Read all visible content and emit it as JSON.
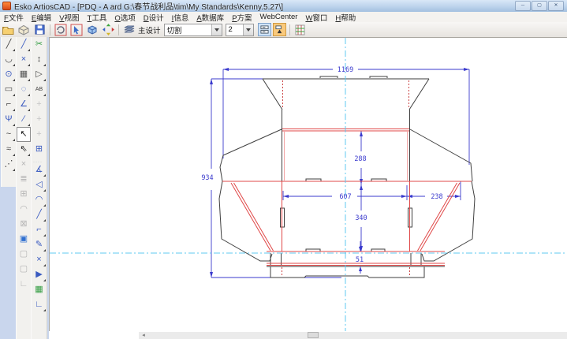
{
  "window": {
    "title": "Esko ArtiosCAD - [PDQ - A ard G:\\春节战利品\\tim\\My Standards\\Kenny.5.27\\]",
    "buttons": {
      "minimize": "─",
      "maximize": "▢",
      "close": "✕"
    }
  },
  "menu": {
    "items": [
      {
        "key": "F",
        "label": "文件"
      },
      {
        "key": "E",
        "label": "编辑"
      },
      {
        "key": "V",
        "label": "视图"
      },
      {
        "key": "T",
        "label": "工具"
      },
      {
        "key": "O",
        "label": "选项"
      },
      {
        "key": "D",
        "label": "设计"
      },
      {
        "key": "I",
        "label": "信息"
      },
      {
        "key": "A",
        "label": "数据库"
      },
      {
        "key": "P",
        "label": "方案"
      },
      {
        "key": "",
        "label": "WebCenter"
      },
      {
        "key": "W",
        "label": "窗口"
      },
      {
        "key": "H",
        "label": "帮助"
      }
    ]
  },
  "toolbar": {
    "design_label": "主设计",
    "layer_dropdown": {
      "value": "切割"
    },
    "zoom_dropdown": {
      "value": "2"
    },
    "icon_names": [
      "open-icon",
      "print-box-icon",
      "save-icon",
      "rebuild-icon",
      "pointer-box-icon",
      "cube-icon",
      "workspace-icon",
      "layers-icon",
      "layer-toggle-icon",
      "snap-toggle-icon",
      "style-table-icon"
    ]
  },
  "tools": {
    "left": [
      {
        "n": "line-tool",
        "g": "╱",
        "c": "#444",
        "f": 1
      },
      {
        "n": "curve-tool",
        "g": "◡",
        "c": "#444",
        "f": 1
      },
      {
        "n": "circle-tool",
        "g": "⊙",
        "c": "#3b5bc0",
        "f": 1
      },
      {
        "n": "rectangle-tool",
        "g": "▭",
        "c": "#444",
        "f": 1
      },
      {
        "n": "fillet-tool",
        "g": "⌐",
        "c": "#444",
        "f": 1
      },
      {
        "n": "branch-tool",
        "g": "Ψ",
        "c": "#3b5bc0",
        "f": 1
      },
      {
        "n": "bezier-tool",
        "g": "~",
        "c": "#444",
        "f": 1
      },
      {
        "n": "wave-tool",
        "g": "≈",
        "c": "#444",
        "f": 1
      },
      {
        "n": "point-line-tool",
        "g": "⋰",
        "c": "#444",
        "f": 1
      }
    ],
    "mid": [
      {
        "n": "line2-tool",
        "g": "╱",
        "c": "#3b5bc0",
        "f": 1
      },
      {
        "n": "intersect-tool",
        "g": "×",
        "c": "#3b5bc0",
        "f": 1
      },
      {
        "n": "hatch-tool",
        "g": "▦",
        "c": "#555",
        "f": 1
      },
      {
        "n": "circle2-tool",
        "g": "◌",
        "c": "#3b5bc0",
        "f": 1
      },
      {
        "n": "angle-lines-tool",
        "g": "∠",
        "c": "#3b5bc0",
        "f": 1
      },
      {
        "n": "measure-tool",
        "g": "∕",
        "c": "#3b5bc0",
        "f": 1
      },
      {
        "n": "select-tool",
        "g": "↖",
        "c": "#111",
        "s": "pressed"
      },
      {
        "n": "group-select-tool",
        "g": "⇖",
        "c": "#222",
        "f": 1
      },
      {
        "n": "delete-tool",
        "g": "×",
        "c": "#b5b5b5",
        "s": "disabled"
      },
      {
        "n": "layers-tool",
        "g": "≣",
        "c": "#b5b5b5",
        "s": "disabled"
      },
      {
        "n": "duplicate-tool",
        "g": "⊞",
        "c": "#b5b5b5",
        "s": "disabled"
      },
      {
        "n": "arc-modify-tool",
        "g": "◠",
        "c": "#b5b5b5",
        "s": "disabled"
      },
      {
        "n": "rect-select-tool",
        "g": "⊠",
        "c": "#b5b5b5",
        "s": "disabled"
      },
      {
        "n": "convert-3d-tool",
        "g": "▣",
        "c": "#2f6fd0"
      },
      {
        "n": "copy-3d-tool",
        "g": "▢",
        "c": "#b5b5b5",
        "s": "disabled"
      },
      {
        "n": "outline-tool",
        "g": "▢",
        "c": "#b5b5b5",
        "s": "disabled"
      },
      {
        "n": "corner-gray-tool",
        "g": "∟",
        "c": "#b5b5b5",
        "s": "disabled"
      }
    ],
    "right": [
      {
        "n": "plot-output-tool",
        "g": "✂",
        "c": "#2e9b3e"
      },
      {
        "n": "move-node-tool",
        "g": "↕",
        "c": "#444",
        "f": 1
      },
      {
        "n": "rotate-shape-tool",
        "g": "▷",
        "c": "#444",
        "f": 1
      },
      {
        "n": "ab-dim-tool",
        "g": "AB",
        "c": "#444",
        "f": 1
      },
      {
        "n": "pan-up-tool",
        "g": "+",
        "c": "#c4c4c4",
        "s": "disabled"
      },
      {
        "n": "pan-mid-tool",
        "g": "+",
        "c": "#c4c4c4",
        "s": "disabled"
      },
      {
        "n": "pan-down-tool",
        "g": "+",
        "c": "#c4c4c4",
        "s": "disabled"
      },
      {
        "n": "move-view-tool",
        "g": "⊞",
        "c": "#3b5bc0"
      },
      {
        "s": "sep"
      },
      {
        "n": "angle-dim-tool",
        "g": "∡",
        "c": "#3b5bc0",
        "f": 1
      },
      {
        "n": "taper-tool",
        "g": "◁",
        "c": "#3b5bc0",
        "f": 1
      },
      {
        "n": "arc-tangent-tool",
        "g": "◠",
        "c": "#3b5bc0",
        "f": 1
      },
      {
        "n": "line-angle-tool",
        "g": "╱",
        "c": "#3b5bc0",
        "f": 1
      },
      {
        "n": "offset-tool",
        "g": "⌐",
        "c": "#3b5bc0",
        "f": 1
      },
      {
        "n": "edit-line-tool",
        "g": "✎",
        "c": "#3b5bc0",
        "f": 1
      },
      {
        "n": "break-tool",
        "g": "×",
        "c": "#3b5bc0",
        "f": 1
      },
      {
        "n": "direction-tool",
        "g": "▶",
        "c": "#3b5bc0",
        "f": 1
      },
      {
        "n": "counter-table-tool",
        "g": "▦",
        "c": "#2e9b3e"
      },
      {
        "n": "stair-step-tool",
        "g": "∟",
        "c": "#3b5bc0",
        "f": 1
      }
    ]
  },
  "drawing": {
    "dims": {
      "total_width": "1169",
      "total_height": "934",
      "lid_depth": "288",
      "panel_width": "607",
      "side_panel": "238",
      "front_height": "340",
      "flap": "51"
    },
    "colors": {
      "dimension": "#3a3acd",
      "cut": "#3f3f3f",
      "crease": "#e04848",
      "perforation": "#f2a6a6",
      "guide": "#5fc8f0"
    }
  },
  "scrollbar": {
    "left_arrow": "◂"
  }
}
